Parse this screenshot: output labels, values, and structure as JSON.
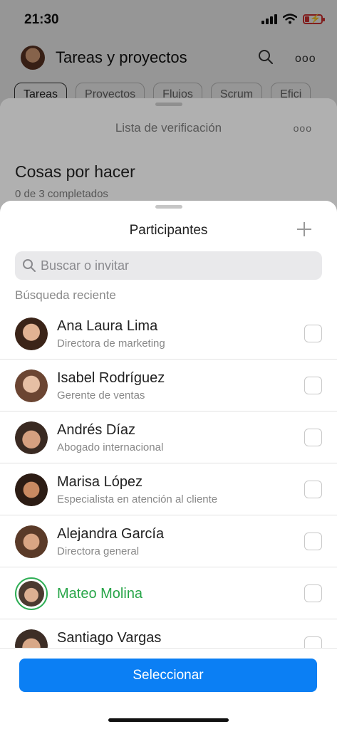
{
  "status": {
    "time": "21:30"
  },
  "header": {
    "title": "Tareas y proyectos",
    "more": "ooo"
  },
  "tabs": [
    "Tareas",
    "Proyectos",
    "Flujos",
    "Scrum",
    "Efici"
  ],
  "checklist": {
    "title": "Lista de verificación",
    "more": "ooo",
    "heading": "Cosas por hacer",
    "progress": "0 de 3 completados"
  },
  "participants": {
    "title": "Participantes",
    "search_placeholder": "Buscar o invitar",
    "section": "Búsqueda reciente",
    "people": [
      {
        "name": "Ana Laura Lima",
        "role": "Directora de marketing",
        "selected": false
      },
      {
        "name": "Isabel Rodríguez",
        "role": "Gerente de ventas",
        "selected": false
      },
      {
        "name": "Andrés Díaz",
        "role": "Abogado internacional",
        "selected": false
      },
      {
        "name": "Marisa López",
        "role": "Especialista en atención al cliente",
        "selected": false
      },
      {
        "name": "Alejandra García",
        "role": "Directora general",
        "selected": false
      },
      {
        "name": "Mateo Molina",
        "role": "",
        "selected": true
      },
      {
        "name": "Santiago Vargas",
        "role": "",
        "selected": false
      }
    ],
    "select_label": "Seleccionar"
  },
  "colors": {
    "accent": "#0b7ff4",
    "selected": "#27a548"
  }
}
